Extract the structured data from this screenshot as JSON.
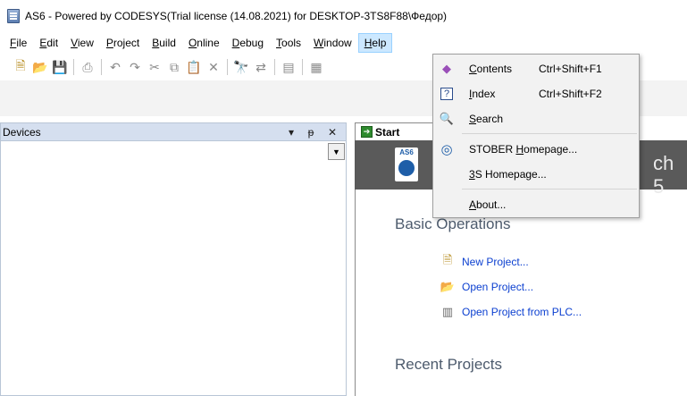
{
  "window": {
    "title": "AS6 - Powered by CODESYS(Trial license (14.08.2021) for DESKTOP-3TS8F88\\Федор)"
  },
  "menubar": {
    "items": [
      {
        "label": "File",
        "u": "F",
        "rest": "ile"
      },
      {
        "label": "Edit",
        "u": "E",
        "rest": "dit"
      },
      {
        "label": "View",
        "u": "V",
        "rest": "iew"
      },
      {
        "label": "Project",
        "u": "P",
        "rest": "roject"
      },
      {
        "label": "Build",
        "u": "B",
        "rest": "uild"
      },
      {
        "label": "Online",
        "u": "O",
        "rest": "nline"
      },
      {
        "label": "Debug",
        "u": "D",
        "rest": "ebug"
      },
      {
        "label": "Tools",
        "u": "T",
        "rest": "ools"
      },
      {
        "label": "Window",
        "u": "W",
        "rest": "indow"
      },
      {
        "label": "Help",
        "u": "H",
        "rest": "elp"
      }
    ]
  },
  "devices_panel": {
    "title": "Devices",
    "pin": "ᵽ",
    "close": "✕",
    "collapse": "▾",
    "dropdown": "▼"
  },
  "start_tab": {
    "label": "Start"
  },
  "banner": {
    "logo_text": "AS6",
    "trailing_text": "ch 5"
  },
  "start_page": {
    "basic_operations": "Basic Operations",
    "links": [
      {
        "label": "New Project..."
      },
      {
        "label": "Open Project..."
      },
      {
        "label": "Open Project from PLC..."
      }
    ],
    "recent_projects": "Recent Projects"
  },
  "help_menu": {
    "items": [
      {
        "u": "C",
        "rest": "ontents",
        "shortcut": "Ctrl+Shift+F1"
      },
      {
        "u": "I",
        "rest": "ndex",
        "shortcut": "Ctrl+Shift+F2"
      },
      {
        "u": "S",
        "rest": "earch",
        "shortcut": ""
      },
      {
        "pre": "STOBER ",
        "u": "H",
        "rest": "omepage...",
        "shortcut": ""
      },
      {
        "pre": "",
        "u": "3",
        "rest": "S Homepage...",
        "shortcut": ""
      },
      {
        "pre": "",
        "u": "A",
        "rest": "bout...",
        "shortcut": ""
      }
    ]
  },
  "colors": {
    "menu_highlight": "#cce8ff",
    "panel_header": "#d5dfef",
    "link": "#0b3fd0",
    "banner": "#5a5a5a"
  }
}
